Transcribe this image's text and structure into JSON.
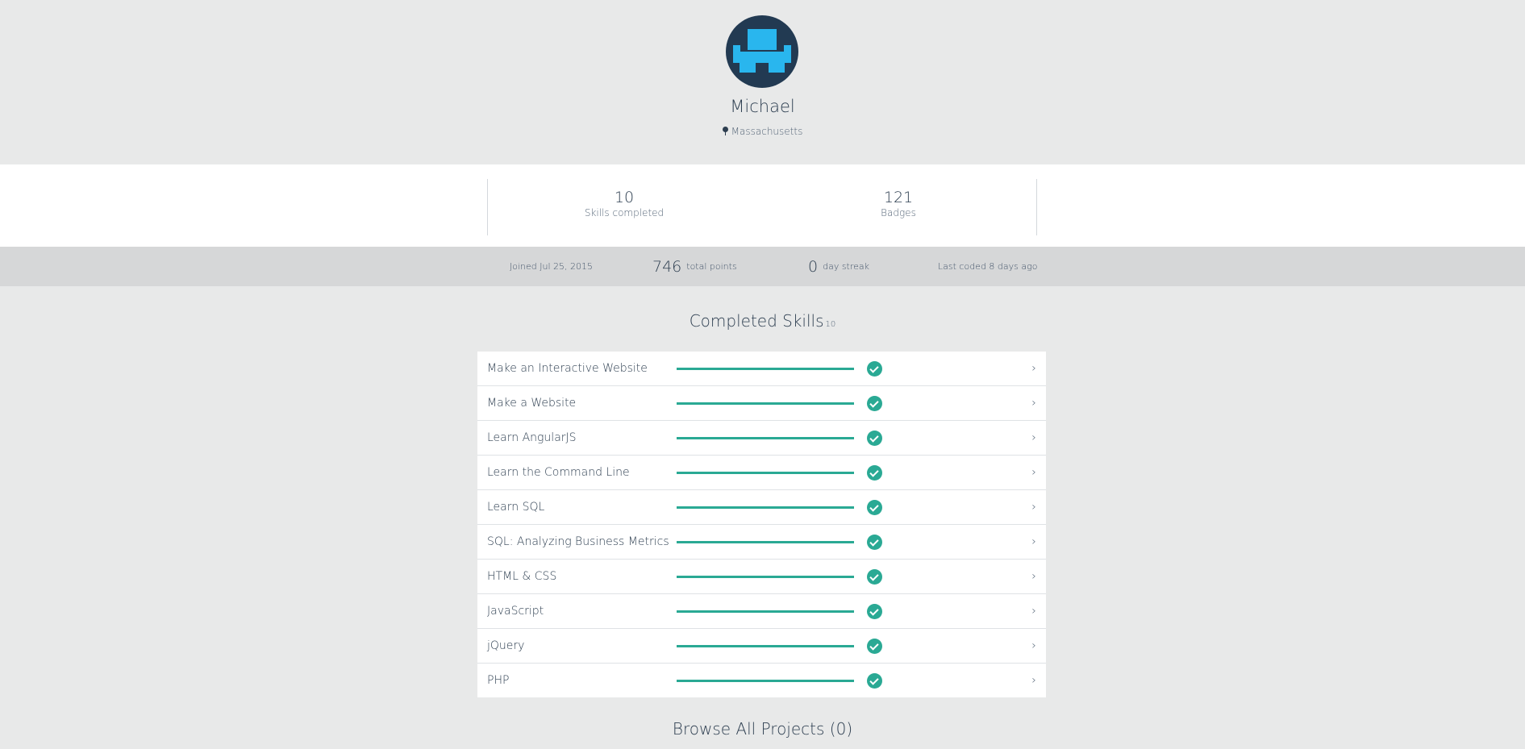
{
  "profile": {
    "name": "Michael",
    "location": "Massachusetts"
  },
  "stats": {
    "skills_completed": {
      "value": "10",
      "label": "Skills completed"
    },
    "badges": {
      "value": "121",
      "label": "Badges"
    }
  },
  "meta": {
    "joined": "Joined Jul 25, 2015",
    "points_value": "746",
    "points_label": "total points",
    "streak_value": "0",
    "streak_label": "day streak",
    "last_coded": "Last coded 8 days ago"
  },
  "completed_skills": {
    "title": "Completed Skills",
    "count": "10",
    "items": [
      {
        "name": "Make an Interactive Website",
        "progress": 1.0
      },
      {
        "name": "Make a Website",
        "progress": 1.0
      },
      {
        "name": "Learn AngularJS",
        "progress": 1.0
      },
      {
        "name": "Learn the Command Line",
        "progress": 1.0
      },
      {
        "name": "Learn SQL",
        "progress": 1.0
      },
      {
        "name": "SQL: Analyzing Business Metrics",
        "progress": 1.0
      },
      {
        "name": "HTML & CSS",
        "progress": 1.0
      },
      {
        "name": "JavaScript",
        "progress": 1.0
      },
      {
        "name": "jQuery",
        "progress": 1.0
      },
      {
        "name": "PHP",
        "progress": 1.0
      }
    ]
  },
  "projects": {
    "title": "Browse All Projects (0)"
  },
  "colors": {
    "accent": "#2aa994",
    "avatar_bg": "#223a52",
    "avatar_fg": "#29b6ee",
    "text": "#2d3e50"
  },
  "icons": {
    "location": "map-pin-icon",
    "check": "check-circle-icon",
    "chevron": "chevron-right-icon"
  }
}
